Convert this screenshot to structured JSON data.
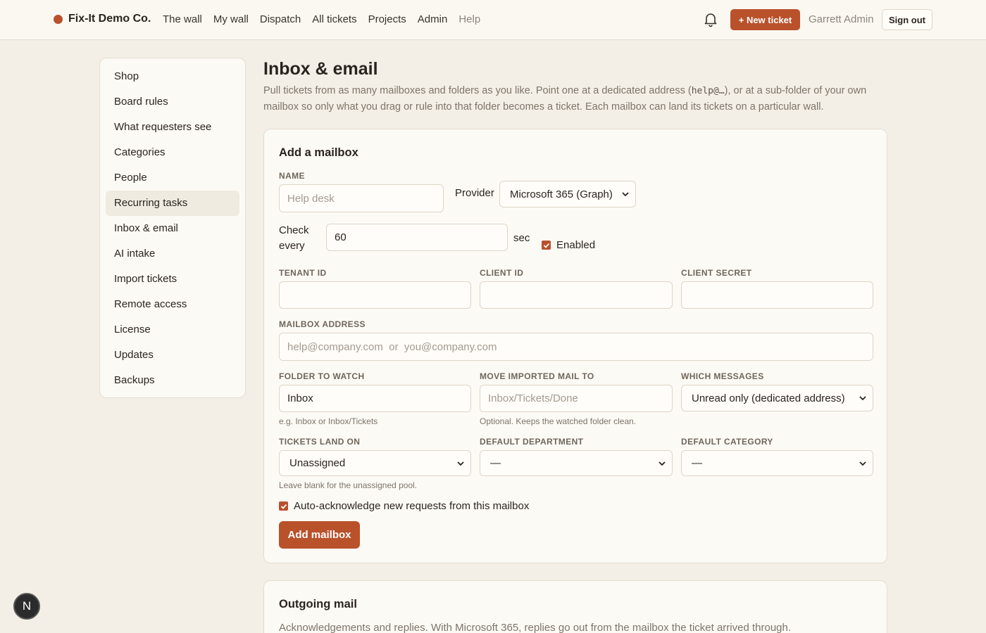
{
  "header": {
    "brand": "Fix-It Demo Co.",
    "nav": [
      "The wall",
      "My wall",
      "Dispatch",
      "All tickets",
      "Projects",
      "Admin",
      "Help"
    ],
    "new_ticket": "+ New ticket",
    "user": "Garrett Admin",
    "sign_out": "Sign out"
  },
  "sidebar": {
    "items": [
      "Shop",
      "Board rules",
      "What requesters see",
      "Categories",
      "People",
      "Recurring tasks",
      "Inbox & email",
      "AI intake",
      "Import tickets",
      "Remote access",
      "License",
      "Updates",
      "Backups"
    ]
  },
  "page": {
    "title": "Inbox & email",
    "desc_a": "Pull tickets from as many mailboxes and folders as you like. Point one at a dedicated address (",
    "desc_code": "help@…",
    "desc_b": "), or at a sub-folder of your own mailbox so only what you drag or rule into that folder becomes a ticket. Each mailbox can land its tickets on a particular wall."
  },
  "add_mailbox": {
    "title": "Add a mailbox",
    "name_label": "Name",
    "name_placeholder": "Help desk",
    "provider_label": "Provider",
    "provider_value": "Microsoft 365 (Graph)",
    "check_label_1": "Check",
    "check_label_2": "every",
    "check_value": "60",
    "check_unit": "sec",
    "enabled_label": "Enabled",
    "tenant_label": "Tenant ID",
    "client_label": "Client ID",
    "secret_label": "Client secret",
    "address_label": "Mailbox address",
    "address_placeholder": "help@company.com  or  you@company.com",
    "folder_label": "Folder to watch",
    "folder_value": "Inbox",
    "folder_hint": "e.g. Inbox or Inbox/Tickets",
    "move_label": "Move imported mail to",
    "move_placeholder": "Inbox/Tickets/Done",
    "move_hint": "Optional. Keeps the watched folder clean.",
    "which_label": "Which messages",
    "which_value": "Unread only (dedicated address)",
    "land_label": "Tickets land on",
    "land_value": "Unassigned",
    "land_hint": "Leave blank for the unassigned pool.",
    "dept_label": "Default department",
    "dept_value": "—",
    "cat_label": "Default category",
    "cat_value": "—",
    "auto_ack_label": "Auto-acknowledge new requests from this mailbox",
    "submit": "Add mailbox"
  },
  "outgoing": {
    "title": "Outgoing mail",
    "desc": "Acknowledgements and replies. With Microsoft 365, replies go out from the mailbox the ticket arrived through."
  },
  "fab_letter": "N",
  "colors": {
    "accent": "#b9512b",
    "background": "#f4efe6",
    "card": "#fcfaf5"
  }
}
